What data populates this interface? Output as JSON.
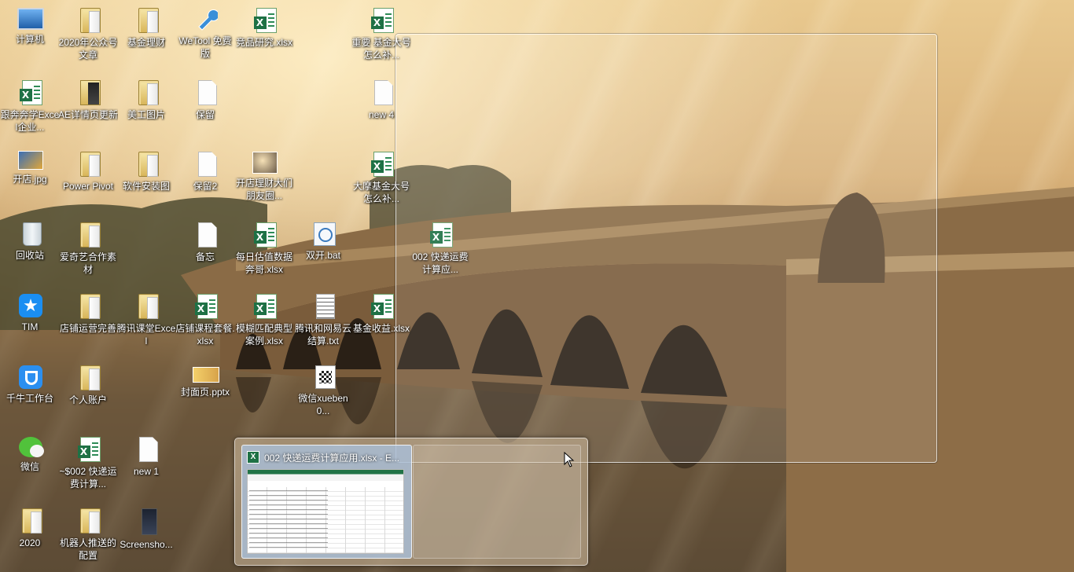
{
  "desktop": {
    "icons": [
      {
        "label": "计算机",
        "kind": "computer"
      },
      {
        "label": "2020年公众号文章",
        "kind": "folder"
      },
      {
        "label": "基金理财",
        "kind": "folder"
      },
      {
        "label": "WeTool 免费版",
        "kind": "wrench"
      },
      {
        "label": "竞品研究.xlsx",
        "kind": "xlsx"
      },
      {
        "label": "重要 基金大号怎么补...",
        "kind": "xlsx"
      },
      {
        "label": "跟奔奔学Excel企业...",
        "kind": "xlsx"
      },
      {
        "label": "AE详情页更新",
        "kind": "bookfolder"
      },
      {
        "label": "美工图片",
        "kind": "folder"
      },
      {
        "label": "保留",
        "kind": "doc"
      },
      {
        "label": "new 4",
        "kind": "doc"
      },
      {
        "label": "开店.jpg",
        "kind": "jpg"
      },
      {
        "label": "Power Pivot",
        "kind": "folder"
      },
      {
        "label": "软件安装图",
        "kind": "folder"
      },
      {
        "label": "保留2",
        "kind": "doc"
      },
      {
        "label": "开店理财大们朋友圈...",
        "kind": "jpg2"
      },
      {
        "label": "大摩基金大号怎么补...",
        "kind": "xlsx"
      },
      {
        "label": "回收站",
        "kind": "recycle"
      },
      {
        "label": "爱奇艺合作素材",
        "kind": "folder"
      },
      {
        "label": "备忘",
        "kind": "doc"
      },
      {
        "label": "每日估值数据奔哥.xlsx",
        "kind": "xlsx"
      },
      {
        "label": "双开.bat",
        "kind": "bat"
      },
      {
        "label": "002 快递运费计算应...",
        "kind": "xlsx"
      },
      {
        "label": "TIM",
        "kind": "tim"
      },
      {
        "label": "店铺运营完善",
        "kind": "folder"
      },
      {
        "label": "腾讯课堂Excel",
        "kind": "folder"
      },
      {
        "label": "店铺课程套餐.xlsx",
        "kind": "xlsx"
      },
      {
        "label": "模糊匹配典型案例.xlsx",
        "kind": "xlsx"
      },
      {
        "label": "腾讯和网易云结算.txt",
        "kind": "txt"
      },
      {
        "label": "基金收益.xlsx",
        "kind": "xlsx"
      },
      {
        "label": "千牛工作台",
        "kind": "qianniu"
      },
      {
        "label": "个人账户",
        "kind": "folder"
      },
      {
        "label": "封面页.pptx",
        "kind": "pptx"
      },
      {
        "label": "微信xueben0...",
        "kind": "qr"
      },
      {
        "label": "微信",
        "kind": "wechat"
      },
      {
        "label": "~$002 快递运费计算...",
        "kind": "xlsx"
      },
      {
        "label": "new 1",
        "kind": "doc"
      },
      {
        "label": "2020",
        "kind": "folder"
      },
      {
        "label": "机器人推送的配置",
        "kind": "folder"
      },
      {
        "label": "Screensho...",
        "kind": "dark"
      }
    ]
  },
  "taskbar_preview": {
    "window_title": "002 快递运费计算应用.xlsx - E...",
    "app_icon": "excel-icon"
  },
  "colors": {
    "excel_green": "#1e7145",
    "preview_highlight": "#aac3e1"
  }
}
